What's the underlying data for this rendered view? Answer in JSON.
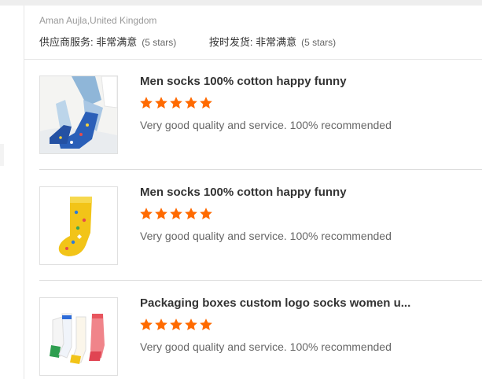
{
  "review": {
    "reviewer": "Aman Aujla,United Kingdom",
    "ratings": [
      {
        "label": "供应商服务: 非常满意",
        "stars_note": "(5 stars)"
      },
      {
        "label": "按时发货: 非常满意",
        "stars_note": "(5 stars)"
      }
    ]
  },
  "products": [
    {
      "title": "Men socks 100% cotton happy funny",
      "rating": 5,
      "comment": "Very good quality and service. 100% recommended"
    },
    {
      "title": "Men socks 100% cotton happy funny",
      "rating": 5,
      "comment": "Very good quality and service. 100% recommended"
    },
    {
      "title": "Packaging boxes custom logo socks women u...",
      "rating": 5,
      "comment": "Very good quality and service. 100% recommended"
    }
  ],
  "colors": {
    "star": "#ff6a00",
    "title": "#333333",
    "comment": "#666666"
  }
}
